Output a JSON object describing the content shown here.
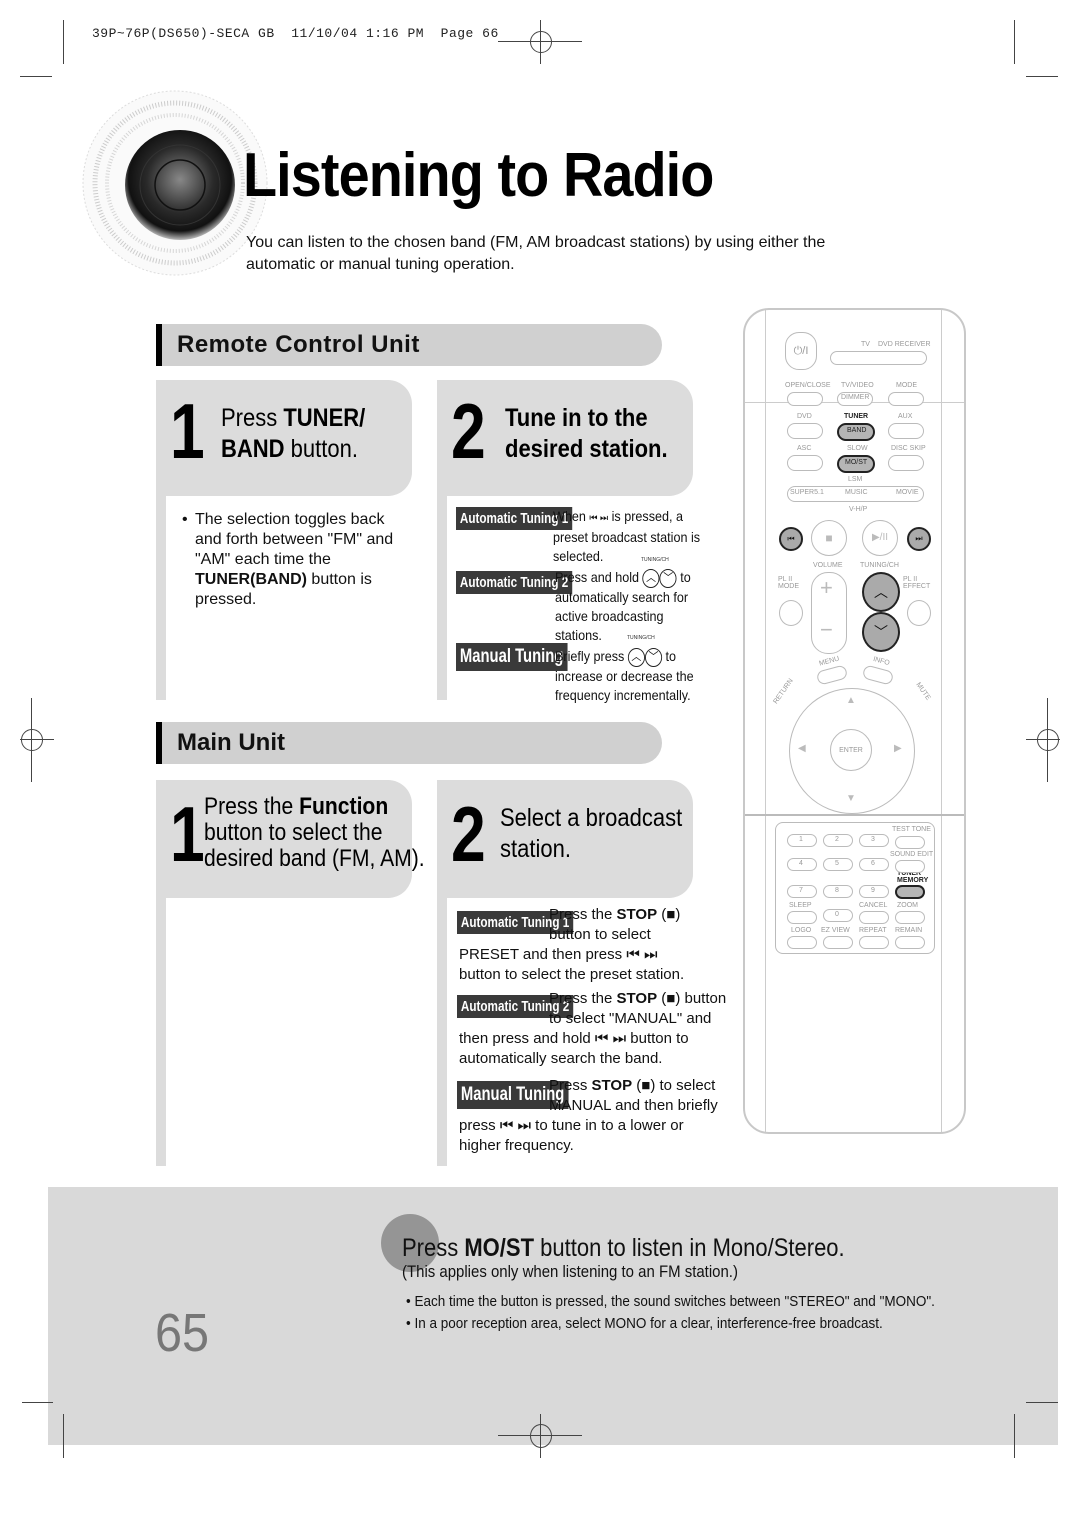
{
  "print_slug": "39P~76P(DS650)-SECA GB  11/10/04 1:16 PM  Page 66",
  "page": {
    "title": "Listening to Radio",
    "intro": "You can listen to the chosen band (FM, AM broadcast stations) by using either the automatic or manual tuning operation.",
    "page_number": "65"
  },
  "remote_section": {
    "heading": "Remote Control Unit",
    "step1": {
      "number": "1",
      "text_pre": "Press ",
      "text_bold1": "TUNER/",
      "text_bold2": "BAND",
      "text_post": " button.",
      "bullet_pre": "The selection toggles back and forth between \"FM\" and \"AM\" each time the ",
      "bullet_bold": "TUNER(BAND)",
      "bullet_post": " button is pressed."
    },
    "step2": {
      "number": "2",
      "line1": "Tune in to the",
      "line2": "desired station.",
      "items": [
        {
          "badge": "Automatic Tuning 1",
          "pre": "When ",
          "icons": "⏮ ⏭",
          "post": " is pressed, a preset broadcast station is selected."
        },
        {
          "badge": "Automatic Tuning 2",
          "caption": "TUNING/CH",
          "pre": "Press and hold ",
          "post": " to automatically search for active broadcasting stations."
        },
        {
          "badge": "Manual Tuning",
          "caption": "TUNING/CH",
          "pre": "Briefly press ",
          "post": " to increase or decrease the frequency incrementally."
        }
      ]
    }
  },
  "main_section": {
    "heading": "Main Unit",
    "step1": {
      "number": "1",
      "line1_pre": "Press the ",
      "line1_bold": "Function",
      "line2": "button to select the",
      "line3": "desired band (FM, AM)."
    },
    "step2": {
      "number": "2",
      "line1": "Select a broadcast",
      "line2": "station.",
      "items": [
        {
          "badge": "Automatic Tuning 1",
          "l1_pre": "Press the ",
          "l1_bold": "STOP",
          "l1_post": " (■)",
          "l2": "button to select",
          "l3": "PRESET and then press ⏮ ⏭",
          "l4": "button to select the preset station."
        },
        {
          "badge": "Automatic Tuning 2",
          "l1_pre": "Press the ",
          "l1_bold": "STOP",
          "l1_post": " (■) button",
          "l2": "to select \"MANUAL\" and",
          "l3": "then press and hold ⏮ ⏭ button to",
          "l4": "automatically search the band."
        },
        {
          "badge": "Manual Tuning",
          "l1_pre": "Press ",
          "l1_bold": "STOP",
          "l1_post": " (■) to select",
          "l2": "MANUAL and then briefly",
          "l3": "press ⏮ ⏭ to tune in to a lower or",
          "l4": "higher frequency."
        }
      ]
    }
  },
  "tip": {
    "head_pre": "Press ",
    "head_bold": "MO/ST",
    "head_post": " button to listen in Mono/Stereo.",
    "sub": "(This applies only when listening to an FM station.)",
    "bullets": [
      "Each time the button is pressed, the sound switches between \"STEREO\" and \"MONO\".",
      "In a poor reception area, select MONO for a clear, interference-free broadcast."
    ]
  },
  "remote": {
    "power": "⏻/I",
    "labels": {
      "tv": "TV",
      "dvd_receiver": "DVD RECEIVER",
      "open_close": "OPEN/CLOSE",
      "tv_video": "TV/VIDEO",
      "mode": "MODE",
      "dimmer": "DIMMER",
      "dvd": "DVD",
      "tuner": "TUNER",
      "band": "BAND",
      "aux": "AUX",
      "asc": "ASC",
      "slow": "SLOW",
      "most": "MO/ST",
      "disc_skip": "DISC SKIP",
      "lsm": "LSM",
      "supers": "SUPER5.1",
      "music": "MUSIC",
      "movie": "MOVIE",
      "vhp": "V-H/P",
      "volume": "VOLUME",
      "tuning_ch": "TUNING/CH",
      "pl2_mode": "PL II MODE",
      "pl2_effect": "PL II EFFECT",
      "menu": "MENU",
      "info": "INFO",
      "return": "RETURN",
      "mute": "MUTE",
      "enter": "ENTER",
      "test_tone": "TEST TONE",
      "sound_edit": "SOUND EDIT",
      "tuner_memory": "TUNER MEMORY",
      "sleep": "SLEEP",
      "cancel": "CANCEL",
      "zoom": "ZOOM",
      "logo": "LOGO",
      "ez_view": "EZ VIEW",
      "repeat": "REPEAT",
      "remain": "REMAIN"
    },
    "digits": [
      "1",
      "2",
      "3",
      "4",
      "5",
      "6",
      "7",
      "8",
      "9",
      "0"
    ]
  }
}
